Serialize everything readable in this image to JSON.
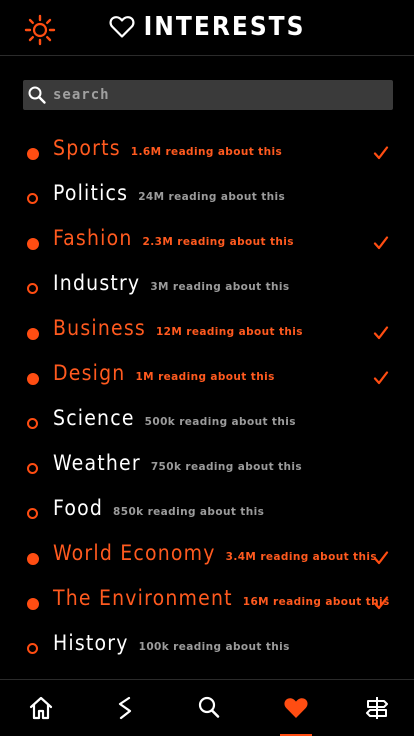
{
  "header": {
    "title": "INTERESTS",
    "settings_icon": "sun-settings-icon",
    "title_icon": "heart-outline-icon"
  },
  "search": {
    "placeholder": "search",
    "value": "",
    "icon": "search-icon"
  },
  "interests": [
    {
      "name": "Sports",
      "meta": "1.6M reading about this",
      "selected": true
    },
    {
      "name": "Politics",
      "meta": "24M reading about this",
      "selected": false
    },
    {
      "name": "Fashion",
      "meta": "2.3M reading about this",
      "selected": true
    },
    {
      "name": "Industry",
      "meta": "3M reading about this",
      "selected": false
    },
    {
      "name": "Business",
      "meta": "12M reading about this",
      "selected": true
    },
    {
      "name": "Design",
      "meta": "1M reading about this",
      "selected": true
    },
    {
      "name": "Science",
      "meta": "500k reading about this",
      "selected": false
    },
    {
      "name": "Weather",
      "meta": "750k reading about this",
      "selected": false
    },
    {
      "name": "Food",
      "meta": "850k reading about this",
      "selected": false
    },
    {
      "name": "World Economy",
      "meta": "3.4M reading about this",
      "selected": true
    },
    {
      "name": "The Environment",
      "meta": "16M reading about this",
      "selected": true
    },
    {
      "name": "History",
      "meta": "100k reading about this",
      "selected": false
    }
  ],
  "tabs": [
    {
      "name": "home",
      "icon": "home-icon",
      "active": false
    },
    {
      "name": "trending",
      "icon": "lightning-icon",
      "active": false
    },
    {
      "name": "search",
      "icon": "search-icon",
      "active": false
    },
    {
      "name": "interests",
      "icon": "heart-icon",
      "active": true
    },
    {
      "name": "settings",
      "icon": "signpost-icon",
      "active": false
    }
  ],
  "colors": {
    "accent": "#ff4d12",
    "background": "#000000",
    "search_bg": "#3a3a3a",
    "muted_text": "#9b9b9b"
  }
}
